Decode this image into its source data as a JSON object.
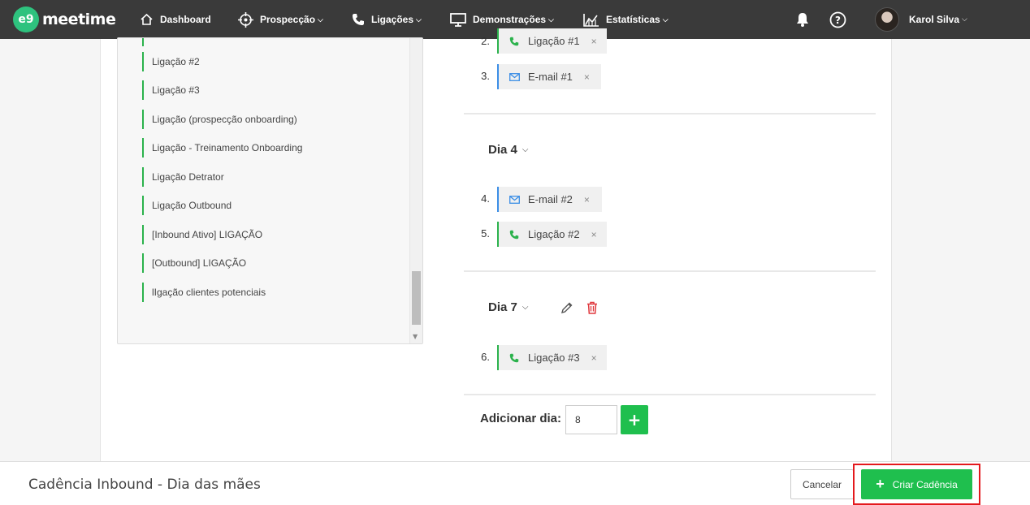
{
  "brand": {
    "badge": "e9",
    "name": "meetime"
  },
  "nav": {
    "dashboard": "Dashboard",
    "prospeccao": "Prospecção",
    "ligacoes": "Ligações",
    "demonstracoes": "Demonstrações",
    "estatisticas": "Estatísticas",
    "user_name": "Karol Silva"
  },
  "left_list": [
    "Ligação #2",
    "Ligação #3",
    "Ligação (prospecção onboarding)",
    "Ligação - Treinamento Onboarding",
    "Ligação Detrator",
    "Ligação Outbound",
    "[Inbound Ativo] LIGAÇÃO",
    "[Outbound] LIGAÇÃO",
    "lIgação clientes potenciais"
  ],
  "cadence": {
    "steps": [
      {
        "num": "2.",
        "type": "call",
        "label": "Ligação #1"
      },
      {
        "num": "3.",
        "type": "mail",
        "label": "E-mail #1"
      },
      {
        "num": "4.",
        "type": "mail",
        "label": "E-mail #2"
      },
      {
        "num": "5.",
        "type": "call",
        "label": "Ligação #2"
      },
      {
        "num": "6.",
        "type": "call",
        "label": "Ligação #3"
      }
    ],
    "days": [
      {
        "title": "Dia 4"
      },
      {
        "title": "Dia 7"
      }
    ],
    "remove_glyph": "×",
    "add_day_label": "Adicionar dia:",
    "add_day_value": "8",
    "add_day_button": "+"
  },
  "footer": {
    "title": "Cadência Inbound - Dia das mães",
    "cancel": "Cancelar",
    "create": "Criar Cadência",
    "create_plus": "+"
  },
  "colors": {
    "accent": "#1fbf4e",
    "call": "#2bb24c",
    "mail": "#3b8ee6",
    "highlight": "#e4191d",
    "delete": "#e0393e"
  },
  "icons": {
    "nav": [
      "home-icon",
      "crosshair-icon",
      "phone-icon",
      "monitor-icon",
      "chart-icon",
      "bell-icon",
      "help-icon"
    ],
    "steps": [
      "phone-icon",
      "envelope-icon",
      "close-icon",
      "edit-icon",
      "trash-icon",
      "chevron-down-icon"
    ]
  }
}
